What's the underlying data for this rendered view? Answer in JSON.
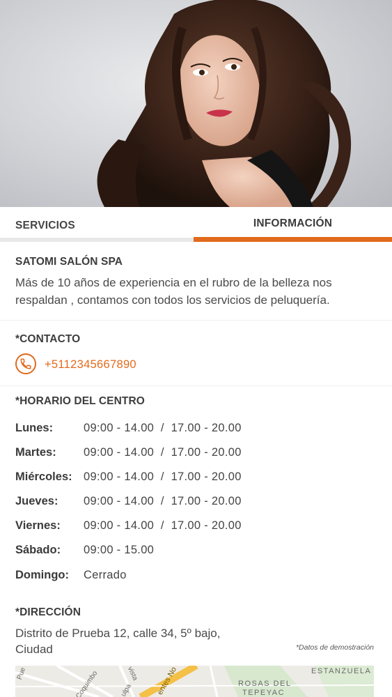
{
  "tabs": {
    "servicios": "SERVICIOS",
    "informacion": "INFORMACIÓN",
    "active": "informacion"
  },
  "salon": {
    "name": "SATOMI SALÓN SPA",
    "description": "Más de 10 años de experiencia en el rubro de la belleza nos respaldan , contamos con todos los servicios de peluquería."
  },
  "contact": {
    "title": "*CONTACTO",
    "phone": "+5112345667890",
    "icon": "phone-icon"
  },
  "schedule": {
    "title": "*HORARIO DEL CENTRO",
    "rows": [
      {
        "day": "Lunes:",
        "hours": "09:00 - 14.00  /  17.00 - 20.00"
      },
      {
        "day": "Martes:",
        "hours": "09:00 - 14.00  /  17.00 - 20.00"
      },
      {
        "day": "Miércoles:",
        "hours": "09:00 - 14.00  /  17.00 - 20.00"
      },
      {
        "day": "Jueves:",
        "hours": "09:00 - 14.00  /  17.00 - 20.00"
      },
      {
        "day": "Viernes:",
        "hours": "09:00 - 14.00  /  17.00 - 20.00"
      },
      {
        "day": "Sábado:",
        "hours": "09:00 - 15.00"
      },
      {
        "day": "Domingo:",
        "hours": "Cerrado"
      }
    ]
  },
  "address": {
    "title": "*DIRECCIÓN",
    "line1": "Distrito de Prueba 12, calle 34, 5º bajo,",
    "line2": "Ciudad",
    "note": "*Datos de demostración"
  },
  "map": {
    "labels": [
      "ESTANZUELA",
      "ROSAS DEL",
      "TEPEYAC",
      "Coquimbo",
      "Pue",
      "vista",
      "entes No",
      "ulpa"
    ]
  },
  "colors": {
    "accent": "#e26a1d",
    "text": "#3c3c3c"
  }
}
